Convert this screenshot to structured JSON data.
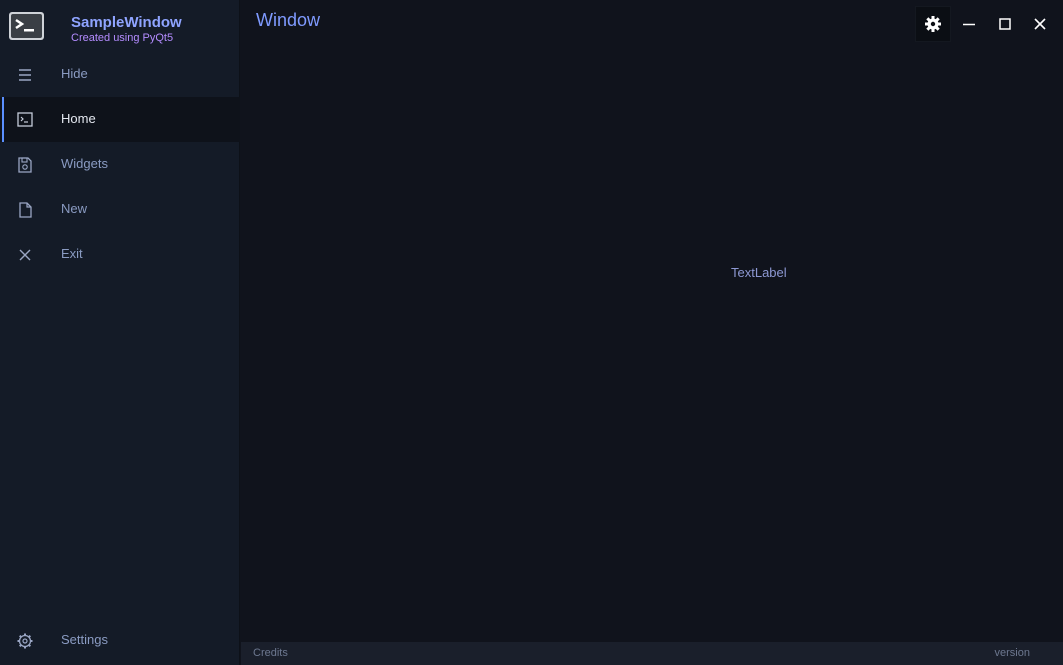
{
  "app": {
    "title": "SampleWindow",
    "subtitle": "Created using PyQt5",
    "icon": "terminal-icon"
  },
  "sidebar": {
    "items": [
      {
        "label": "Hide",
        "icon": "menu-icon",
        "active": false
      },
      {
        "label": "Home",
        "icon": "terminal-icon",
        "active": true
      },
      {
        "label": "Widgets",
        "icon": "save-icon",
        "active": false
      },
      {
        "label": "New",
        "icon": "file-icon",
        "active": false
      },
      {
        "label": "Exit",
        "icon": "close-icon",
        "active": false
      }
    ],
    "settings": {
      "label": "Settings",
      "icon": "gear-icon"
    }
  },
  "window": {
    "title": "Window",
    "controls": [
      "settings-gear-icon",
      "minimize-icon",
      "maximize-icon",
      "close-icon"
    ]
  },
  "main": {
    "text_label": "TextLabel"
  },
  "footer": {
    "credits": "Credits",
    "version": "version"
  },
  "colors": {
    "accent": "#5a8fff",
    "brand_title": "#8fa4ff",
    "brand_subtitle": "#b48cff",
    "background": "#10131c",
    "sidebar": "#141b27"
  }
}
